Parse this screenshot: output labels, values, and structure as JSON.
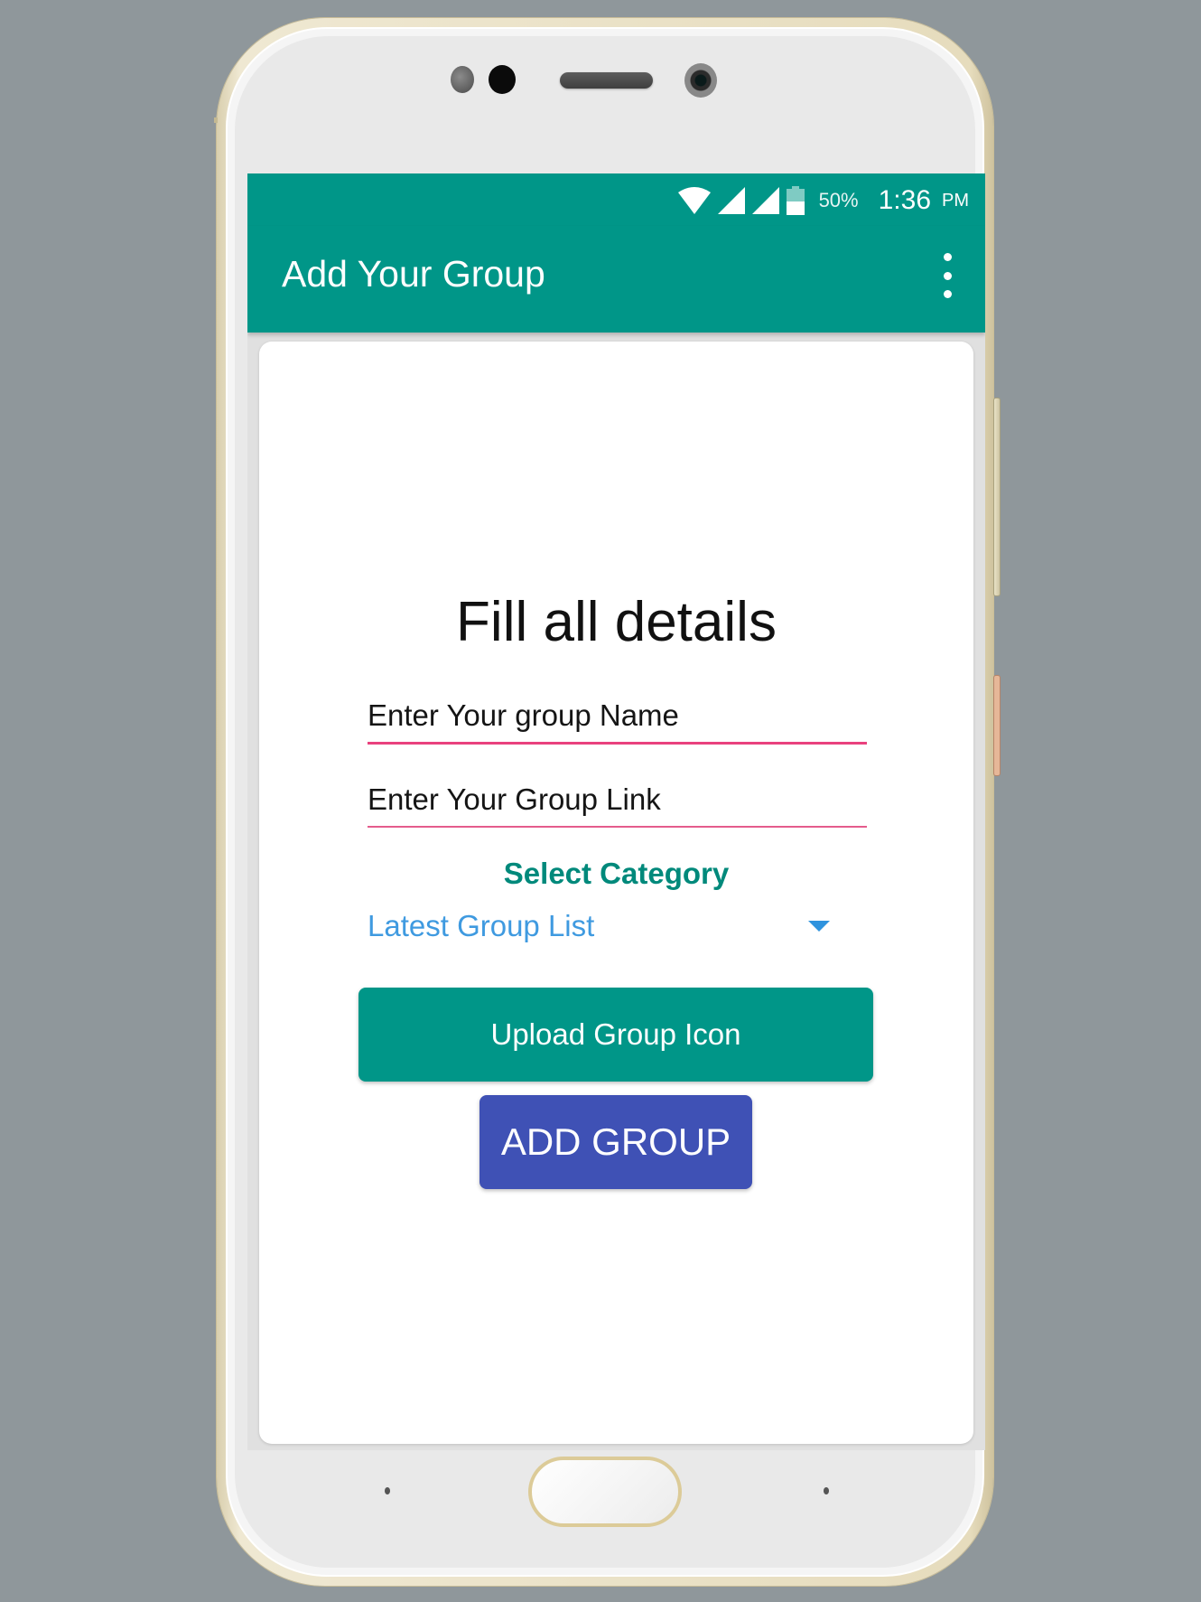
{
  "status_bar": {
    "icons": [
      "wifi-icon",
      "signal-icon",
      "signal-icon",
      "battery-icon"
    ],
    "battery_percent": "50%",
    "time": "1:36",
    "ampm": "PM"
  },
  "app_bar": {
    "title": "Add Your Group",
    "menu_icon": "more-vert-icon"
  },
  "form": {
    "title": "Fill all details",
    "group_name": {
      "placeholder": "Enter Your group Name",
      "value": ""
    },
    "group_link": {
      "placeholder": "Enter Your Group Link",
      "value": ""
    },
    "category_label": "Select Category",
    "category_selected": "Latest Group List",
    "upload_button": "Upload Group Icon",
    "add_button": "ADD GROUP"
  },
  "colors": {
    "primary": "#009688",
    "accent": "#e9417e",
    "add_button": "#3f51b5",
    "spinner_text": "#3f9ae0",
    "category_label": "#00897b"
  }
}
